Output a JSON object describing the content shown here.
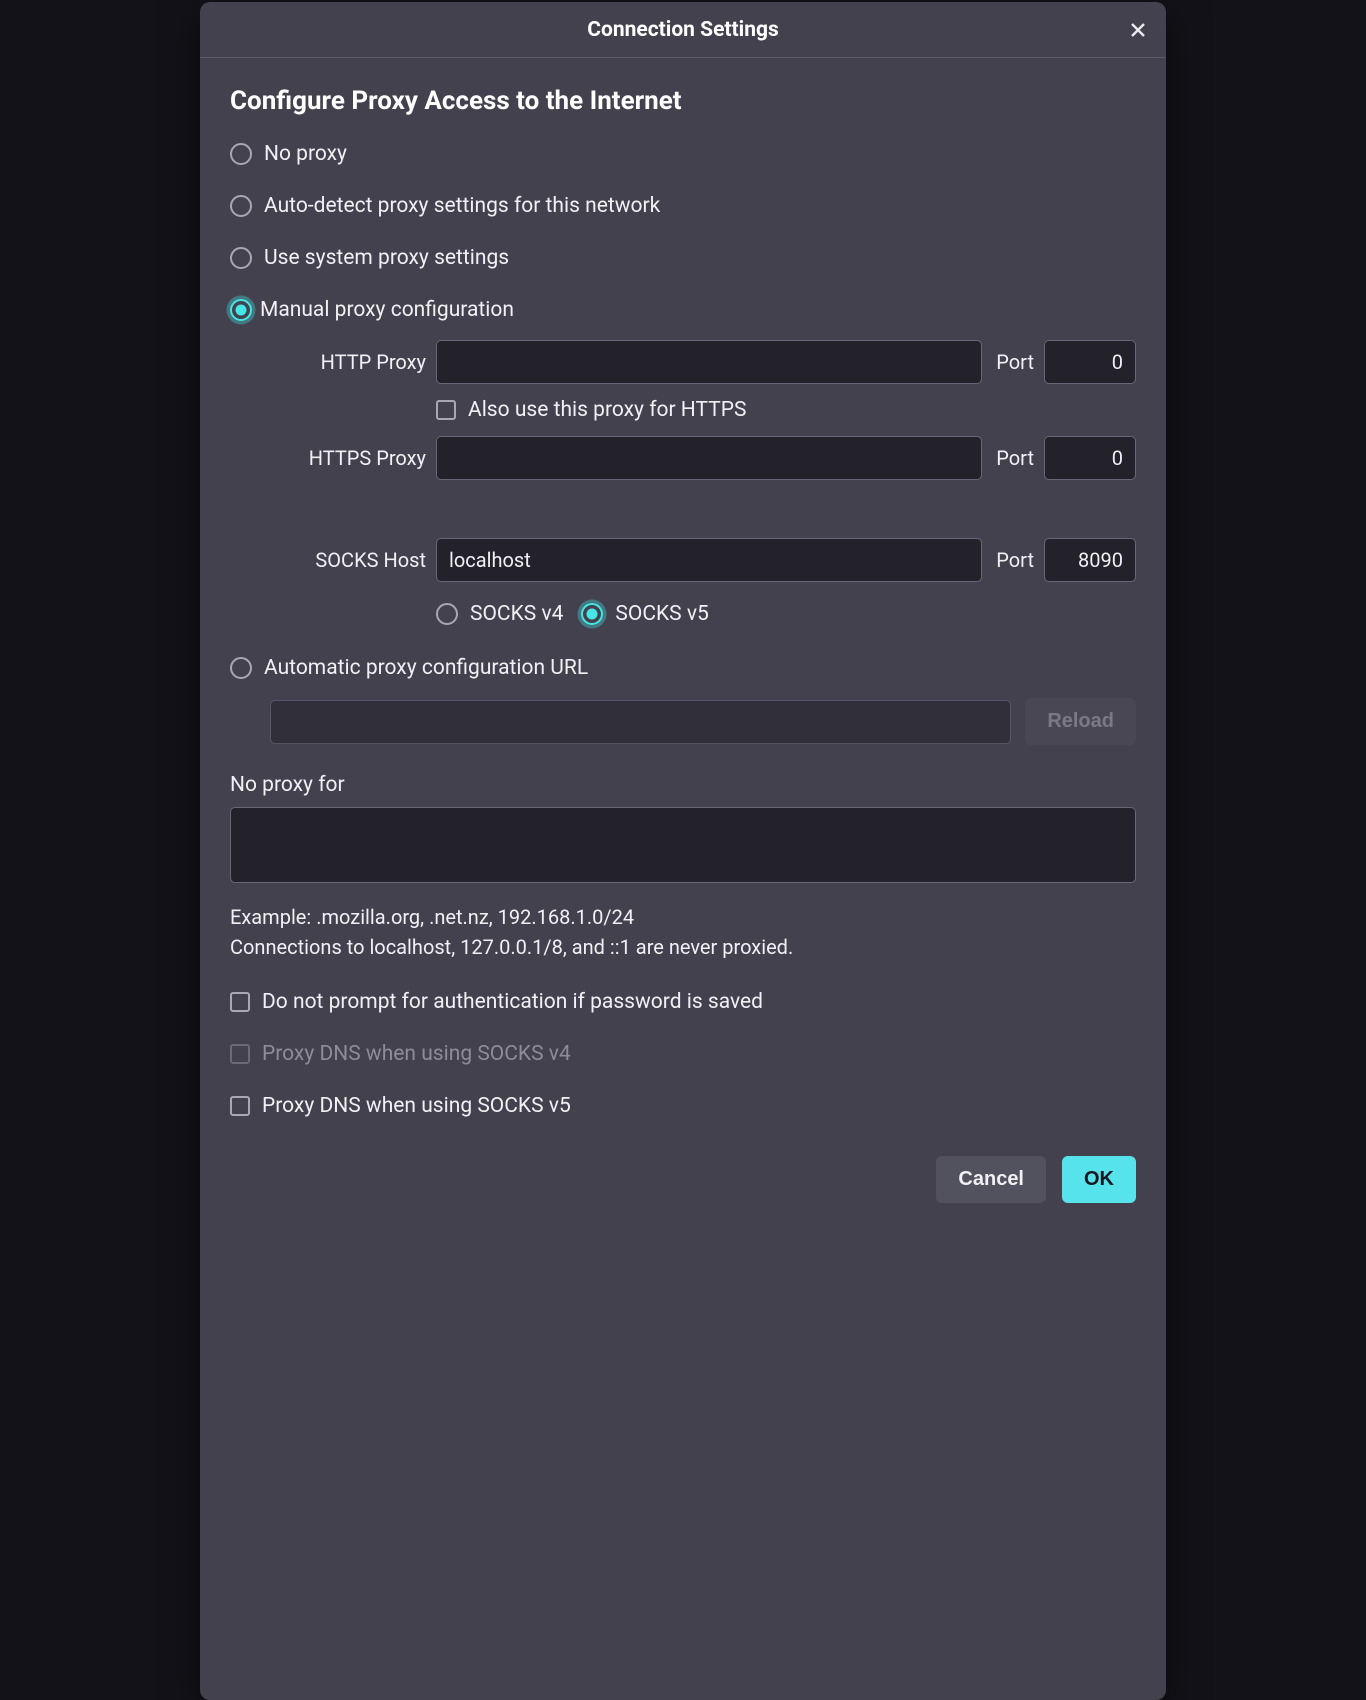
{
  "dialog": {
    "title": "Connection Settings"
  },
  "section": {
    "heading": "Configure Proxy Access to the Internet"
  },
  "radios": {
    "no_proxy": "No proxy",
    "auto_detect": "Auto-detect proxy settings for this network",
    "system": "Use system proxy settings",
    "manual": "Manual proxy configuration",
    "auto_url": "Automatic proxy configuration URL"
  },
  "fields": {
    "http_label": "HTTP Proxy",
    "http_value": "",
    "http_port": "0",
    "also_https_label": "Also use this proxy for HTTPS",
    "https_label": "HTTPS Proxy",
    "https_value": "",
    "https_port": "0",
    "socks_label": "SOCKS Host",
    "socks_value": "localhost",
    "socks_port": "8090",
    "port_label": "Port",
    "socks_v4": "SOCKS v4",
    "socks_v5": "SOCKS v5"
  },
  "autourl": {
    "value": "",
    "reload": "Reload"
  },
  "noproxy": {
    "label": "No proxy for",
    "value": "",
    "example": "Example: .mozilla.org, .net.nz, 192.168.1.0/24",
    "note": "Connections to localhost, 127.0.0.1/8, and ::1 are never proxied."
  },
  "checks": {
    "no_prompt": "Do not prompt for authentication if password is saved",
    "proxy_dns_v4": "Proxy DNS when using SOCKS v4",
    "proxy_dns_v5": "Proxy DNS when using SOCKS v5"
  },
  "actions": {
    "cancel": "Cancel",
    "ok": "OK"
  }
}
